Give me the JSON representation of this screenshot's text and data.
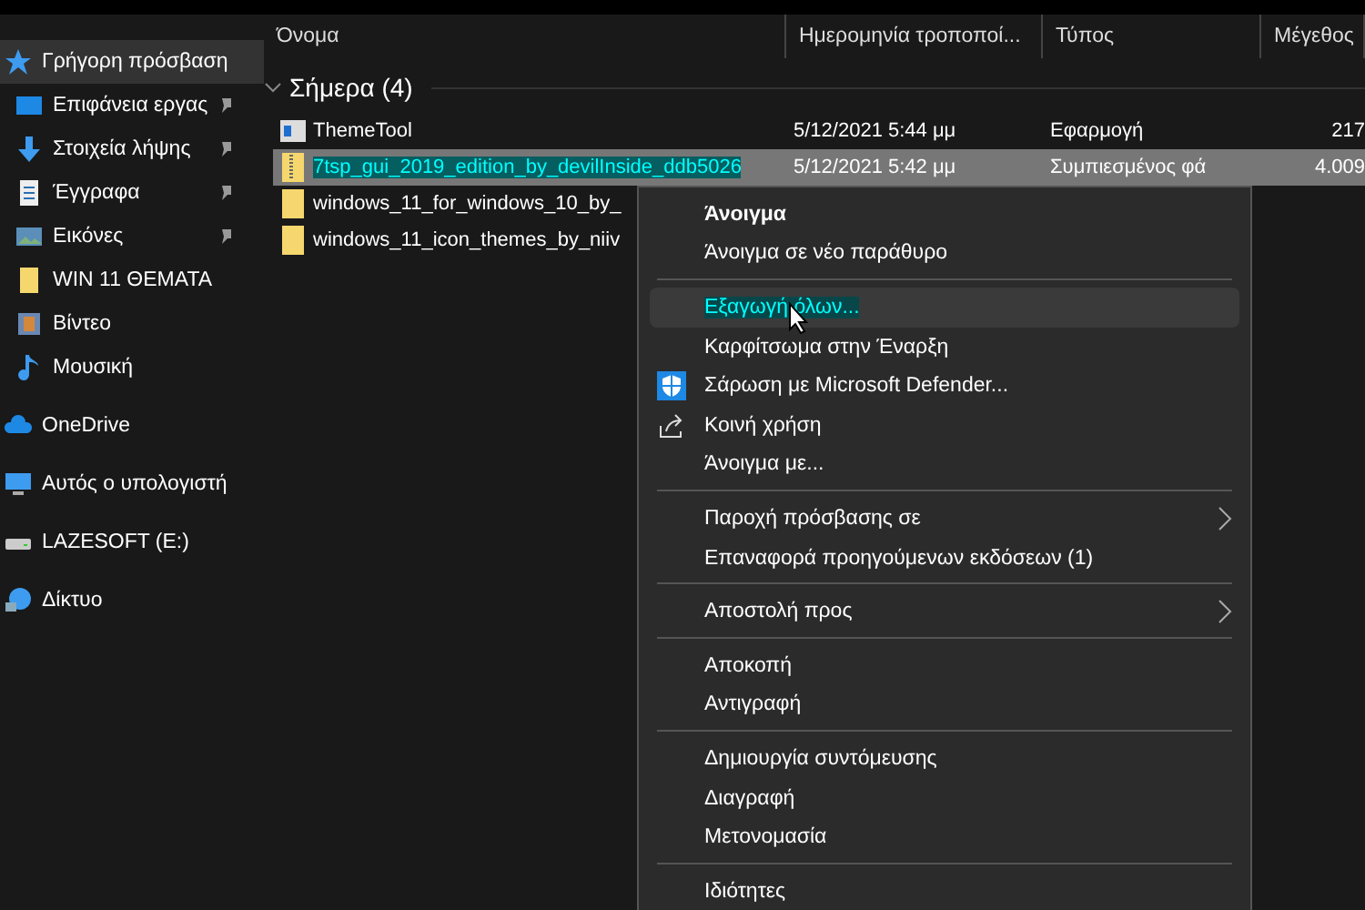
{
  "sidebar": {
    "items": [
      {
        "label": "Γρήγορη πρόσβαση",
        "kind": "star",
        "selected": true,
        "children": [
          {
            "label": "Επιφάνεια εργας",
            "kind": "desktop",
            "pinned": true,
            "selected": false
          },
          {
            "label": "Στοιχεία λήψης",
            "kind": "download",
            "pinned": true,
            "selected": false
          },
          {
            "label": "Έγγραφα",
            "kind": "document",
            "pinned": true,
            "selected": false
          },
          {
            "label": "Εικόνες",
            "kind": "pictures",
            "pinned": true,
            "selected": false
          },
          {
            "label": "WIN 11 ΘΕΜΑΤΑ",
            "kind": "folder",
            "pinned": false,
            "selected": false
          },
          {
            "label": "Βίντεο",
            "kind": "video",
            "pinned": false,
            "selected": false
          },
          {
            "label": "Μουσική",
            "kind": "music",
            "pinned": false,
            "selected": false
          }
        ]
      },
      {
        "label": "OneDrive",
        "kind": "cloud",
        "selected": false
      },
      {
        "label": "Αυτός ο υπολογιστή",
        "kind": "computer",
        "selected": false
      },
      {
        "label": "LAZESOFT (E:)",
        "kind": "drive",
        "selected": false
      },
      {
        "label": "Δίκτυο",
        "kind": "network",
        "selected": false
      }
    ]
  },
  "table": {
    "columns": [
      "Όνομα",
      "Ημερομηνία τροποποί...",
      "Τύπος",
      "Μέγεθος"
    ],
    "group": {
      "label": "Σήμερα (4)",
      "expanded": true
    },
    "rows": [
      {
        "kind": "app",
        "selected": false,
        "cells": [
          "ThemeTool",
          "5/12/2021 5:44 μμ",
          "Εφαρμογή",
          "217"
        ]
      },
      {
        "kind": "zip",
        "selected": true,
        "cells": [
          "7tsp_gui_2019_edition_by_devilInside_ddb5026",
          "5/12/2021 5:42 μμ",
          "Συμπιεσμένος φά",
          "4.009"
        ]
      },
      {
        "kind": "folder",
        "selected": false,
        "cells": [
          "windows_11_for_windows_10_by_"
        ]
      },
      {
        "kind": "folder",
        "selected": false,
        "cells": [
          "windows_11_icon_themes_by_niiv"
        ]
      }
    ]
  },
  "context_menu": {
    "items": [
      {
        "kind": "item",
        "label": "Άνοιγμα",
        "default": true,
        "selected": false
      },
      {
        "kind": "item",
        "label": "Άνοιγμα σε νέο παράθυρο",
        "selected": false
      },
      {
        "kind": "separator"
      },
      {
        "kind": "item",
        "label": "Εξαγωγή όλων...",
        "selected": true
      },
      {
        "kind": "item",
        "label": "Καρφίτσωμα στην Έναρξη",
        "selected": false
      },
      {
        "kind": "shield_item",
        "label": "Σάρωση με Microsoft Defender...",
        "selected": false
      },
      {
        "kind": "share_item",
        "label": "Κοινή χρήση",
        "selected": false
      },
      {
        "kind": "item",
        "label": "Άνοιγμα με...",
        "selected": false
      },
      {
        "kind": "separator"
      },
      {
        "kind": "item",
        "label": "Παροχή πρόσβασης σε",
        "submenu": true,
        "selected": false
      },
      {
        "kind": "item",
        "label": "Επαναφορά προηγούμενων εκδόσεων (1)",
        "selected": false
      },
      {
        "kind": "separator"
      },
      {
        "kind": "item",
        "label": "Αποστολή προς",
        "submenu": true,
        "selected": false
      },
      {
        "kind": "separator"
      },
      {
        "kind": "item",
        "label": "Αποκοπή",
        "selected": false
      },
      {
        "kind": "item",
        "label": "Αντιγραφή",
        "selected": false
      },
      {
        "kind": "separator"
      },
      {
        "kind": "item",
        "label": "Δημιουργία συντόμευσης",
        "selected": false
      },
      {
        "kind": "item",
        "label": "Διαγραφή",
        "selected": false
      },
      {
        "kind": "item",
        "label": "Μετονομασία",
        "selected": false
      },
      {
        "kind": "separator"
      },
      {
        "kind": "item",
        "label": "Ιδιότητες",
        "selected": false
      }
    ]
  }
}
